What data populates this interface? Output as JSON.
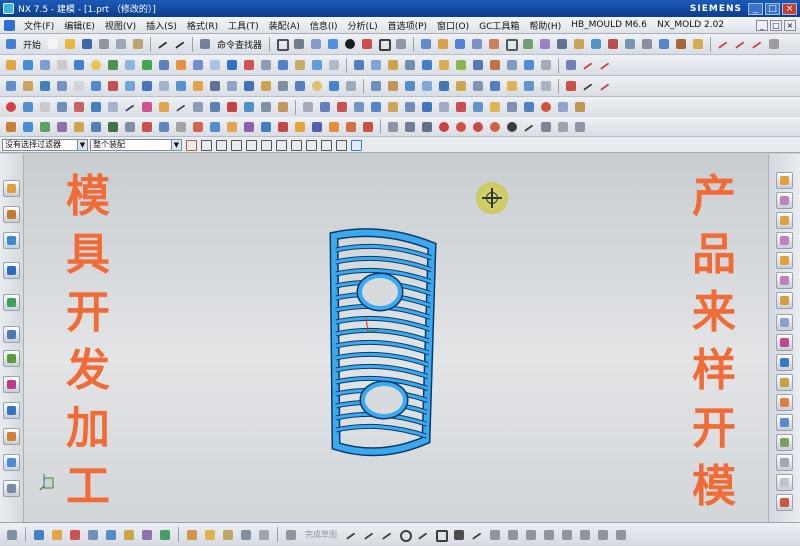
{
  "window": {
    "title": "NX 7.5 - 建模 - [1.prt （修改的）]",
    "brand": "SIEMENS",
    "controls": [
      "_",
      "□",
      "×"
    ]
  },
  "menubar": {
    "items": [
      "文件(F)",
      "编辑(E)",
      "视图(V)",
      "插入(S)",
      "格式(R)",
      "工具(T)",
      "装配(A)",
      "信息(I)",
      "分析(L)",
      "首选项(P)",
      "窗口(O)",
      "GC工具箱",
      "帮助(H)",
      "HB_MOULD M6.6",
      "NX_MOLD 2.02"
    ],
    "mdi_controls": [
      "_",
      "□",
      "×"
    ]
  },
  "toolbar": {
    "start_label": "开始",
    "command_finder_label": "命令查找器"
  },
  "selection_bar": {
    "filter_value": "没有选择过滤器",
    "scope_value": "整个装配"
  },
  "bottom_toolbar": {
    "sketch_label": "完成草图"
  },
  "overlay": {
    "left_text": [
      "模",
      "具",
      "开",
      "发",
      "加",
      "工"
    ],
    "right_text": [
      "产",
      "品",
      "来",
      "样",
      "开",
      "模"
    ],
    "text_color": "#f06b36"
  },
  "model": {
    "body_color": "#3aa9f0",
    "edge_color": "#0b3a66"
  },
  "icons": {
    "row1": [
      "start-icon",
      "new-icon",
      "open-icon",
      "save-icon",
      "cut-icon",
      "copy-icon",
      "paste-icon",
      "undo-icon",
      "redo-icon",
      "command-finder-icon"
    ],
    "row1_right": [
      "selection-icon",
      "view-orient-icon",
      "render-style-icon",
      "shaded-icon",
      "layer-icon",
      "sketch-icon",
      "datum-plane-icon",
      "extrude-icon",
      "revolve-icon",
      "hole-icon",
      "blend-icon",
      "chamfer-icon",
      "line-icon",
      "arc-icon",
      "spline-icon"
    ],
    "left_resource": [
      "assembly-navigator-icon",
      "constraint-navigator-icon",
      "part-navigator-icon",
      "reuse-library-icon",
      "web-browser-icon",
      "history-icon",
      "system-materials-icon",
      "process-studio-icon",
      "roles-icon",
      "system-scenes-icon"
    ],
    "right_toolbar": [
      "front-view-icon",
      "back-view-icon",
      "top-view-icon",
      "bottom-view-icon",
      "left-view-icon",
      "right-view-icon",
      "iso-view-icon",
      "trimetric-view-icon"
    ]
  }
}
